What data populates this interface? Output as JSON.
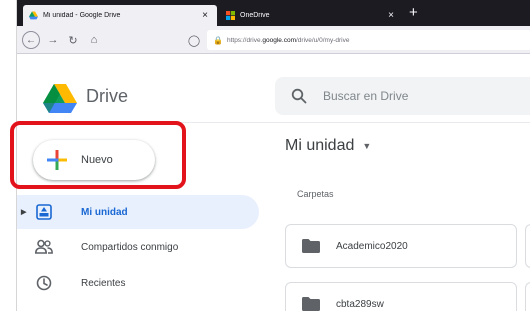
{
  "browser": {
    "tabs": [
      {
        "label": "Mi unidad - Google Drive",
        "active": true
      },
      {
        "label": "OneDrive",
        "active": false
      }
    ],
    "close_glyph": "×",
    "new_tab_glyph": "+",
    "url_prefix": "https://drive.",
    "url_domain": "google.com",
    "url_path": "/drive/u/0/my-drive"
  },
  "app": {
    "title": "Drive",
    "search_placeholder": "Buscar en Drive"
  },
  "sidebar": {
    "new_label": "Nuevo",
    "items": [
      {
        "label": "Mi unidad",
        "icon": "my-drive-icon",
        "active": true
      },
      {
        "label": "Compartidos conmigo",
        "icon": "shared-people-icon",
        "active": false
      },
      {
        "label": "Recientes",
        "icon": "clock-icon",
        "active": false
      }
    ]
  },
  "main": {
    "title": "Mi unidad",
    "section_label": "Carpetas",
    "folders": [
      {
        "name": "Academico2020"
      },
      {
        "name": "cbta289sw"
      }
    ]
  },
  "colors": {
    "highlight": "#e3131b",
    "active_nav_bg": "#e8f0fe",
    "active_nav_text": "#1967d2"
  }
}
